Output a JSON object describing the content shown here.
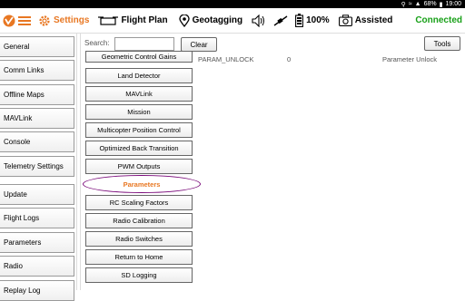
{
  "statusbar": {
    "battery": "68%",
    "time": "19:00"
  },
  "toolbar": {
    "settings_label": "Settings",
    "flight_plan_label": "Flight Plan",
    "geotagging_label": "Geotagging",
    "battery_label": "100%",
    "mode_label": "Assisted",
    "connection_label": "Connected"
  },
  "sidebar": {
    "items": [
      {
        "label": "General"
      },
      {
        "label": "Comm Links"
      },
      {
        "label": "Offline Maps"
      },
      {
        "label": "MAVLink"
      },
      {
        "label": "Console"
      },
      {
        "label": "Telemetry Settings"
      },
      {
        "label": "Update"
      },
      {
        "label": "Flight Logs"
      },
      {
        "label": "Parameters"
      },
      {
        "label": "Radio"
      },
      {
        "label": "Replay Log"
      }
    ]
  },
  "parameters": {
    "search_label": "Search:",
    "search_value": "",
    "clear_label": "Clear",
    "tools_label": "Tools",
    "groups": [
      {
        "label": "Geometric Control Gains"
      },
      {
        "label": "Land Detector"
      },
      {
        "label": "MAVLink"
      },
      {
        "label": "Mission"
      },
      {
        "label": "Multicopter Position Control"
      },
      {
        "label": "Optimized Back Transition"
      },
      {
        "label": "PWM Outputs"
      },
      {
        "label": "Parameters"
      },
      {
        "label": "RC Scaling Factors"
      },
      {
        "label": "Radio Calibration"
      },
      {
        "label": "Radio Switches"
      },
      {
        "label": "Return to Home"
      },
      {
        "label": "SD Logging"
      }
    ],
    "selected_group": "Parameters",
    "rows": [
      {
        "name": "PARAM_UNLOCK",
        "value": "0",
        "description": "Parameter Unlock"
      }
    ]
  }
}
